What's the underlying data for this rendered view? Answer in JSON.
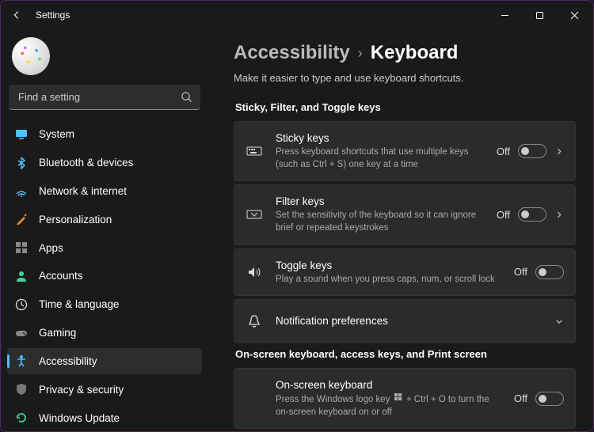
{
  "window": {
    "title": "Settings"
  },
  "search": {
    "placeholder": "Find a setting"
  },
  "nav": {
    "items": [
      {
        "id": "system",
        "label": "System"
      },
      {
        "id": "bluetooth",
        "label": "Bluetooth & devices"
      },
      {
        "id": "network",
        "label": "Network & internet"
      },
      {
        "id": "personalization",
        "label": "Personalization"
      },
      {
        "id": "apps",
        "label": "Apps"
      },
      {
        "id": "accounts",
        "label": "Accounts"
      },
      {
        "id": "time",
        "label": "Time & language"
      },
      {
        "id": "gaming",
        "label": "Gaming"
      },
      {
        "id": "accessibility",
        "label": "Accessibility",
        "active": true
      },
      {
        "id": "privacy",
        "label": "Privacy & security"
      },
      {
        "id": "update",
        "label": "Windows Update"
      }
    ]
  },
  "breadcrumb": {
    "parent": "Accessibility",
    "current": "Keyboard"
  },
  "subtitle": "Make it easier to type and use keyboard shortcuts.",
  "sections": [
    {
      "heading": "Sticky, Filter, and Toggle keys",
      "items": [
        {
          "id": "sticky",
          "title": "Sticky keys",
          "desc": "Press keyboard shortcuts that use multiple keys (such as Ctrl + S) one key at a time",
          "state": "Off",
          "toggle": true,
          "chevron": true,
          "icon": "sticky-keys-icon"
        },
        {
          "id": "filter",
          "title": "Filter keys",
          "desc": "Set the sensitivity of the keyboard so it can ignore brief or repeated keystrokes",
          "state": "Off",
          "toggle": true,
          "chevron": true,
          "icon": "filter-keys-icon"
        },
        {
          "id": "toggle",
          "title": "Toggle keys",
          "desc": "Play a sound when you press caps, num, or scroll lock",
          "state": "Off",
          "toggle": true,
          "chevron": false,
          "icon": "toggle-keys-icon"
        },
        {
          "id": "notif",
          "title": "Notification preferences",
          "desc": "",
          "state": "",
          "toggle": false,
          "chevron": true,
          "chevronDown": true,
          "icon": "bell-icon"
        }
      ]
    },
    {
      "heading": "On-screen keyboard, access keys, and Print screen",
      "items": [
        {
          "id": "osk",
          "title": "On-screen keyboard",
          "desc_pre": "Press the Windows logo key ",
          "desc_post": " + Ctrl + O to turn the on-screen keyboard on or off",
          "state": "Off",
          "toggle": true,
          "chevron": false,
          "icon": ""
        }
      ]
    }
  ]
}
